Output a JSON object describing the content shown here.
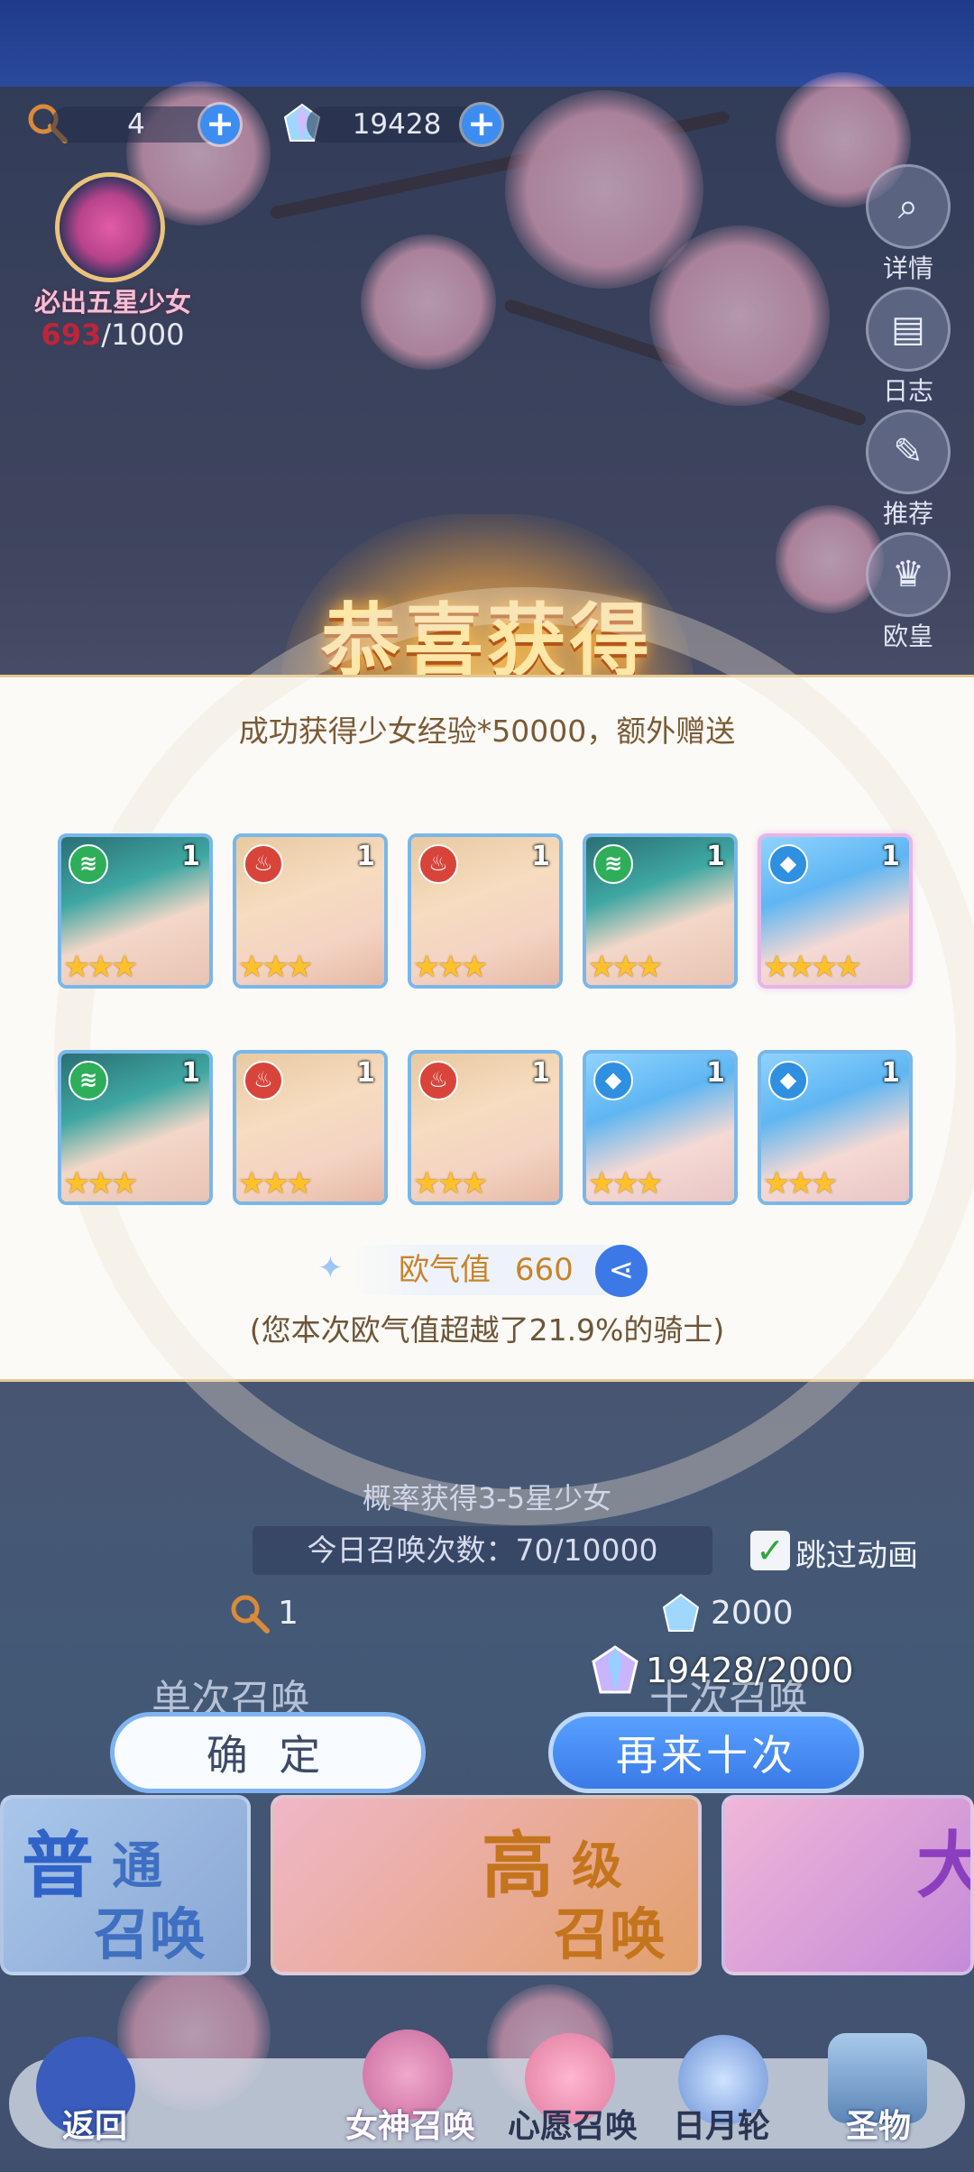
{
  "resources": {
    "ticket_count": "4",
    "gem_count": "19428"
  },
  "guarantee": {
    "title": "必出五星少女",
    "current": "693",
    "total": "/1000"
  },
  "side_menu": [
    {
      "label": "详情",
      "icon": "magnifier-icon"
    },
    {
      "label": "日志",
      "icon": "book-icon"
    },
    {
      "label": "推荐",
      "icon": "feather-icon"
    },
    {
      "label": "欧皇",
      "icon": "crown-icon"
    }
  ],
  "reward": {
    "title": "恭喜获得",
    "message": "成功获得少女经验*50000，额外赠送",
    "cards": [
      {
        "element": "wind",
        "level": "1",
        "stars": "★★★"
      },
      {
        "element": "fire",
        "level": "1",
        "stars": "★★★"
      },
      {
        "element": "fire",
        "level": "1",
        "stars": "★★★"
      },
      {
        "element": "wind",
        "level": "1",
        "stars": "★★★"
      },
      {
        "element": "water",
        "level": "1",
        "stars": "★★★★"
      },
      {
        "element": "wind",
        "level": "1",
        "stars": "★★★"
      },
      {
        "element": "fire",
        "level": "1",
        "stars": "★★★"
      },
      {
        "element": "fire",
        "level": "1",
        "stars": "★★★"
      },
      {
        "element": "water",
        "level": "1",
        "stars": "★★★"
      },
      {
        "element": "water",
        "level": "1",
        "stars": "★★★"
      }
    ],
    "luck_label": "欧气值",
    "luck_value": "660",
    "luck_sub": "(您本次欧气值超越了21.9%的骑士)"
  },
  "summon": {
    "probability_text": "概率获得3-5星少女",
    "today_count": "今日召唤次数：70/10000",
    "skip_label": "跳过动画",
    "single_cost": "1",
    "ten_cost": "2000",
    "single_label": "单次召唤",
    "ten_label": "十次召唤",
    "gem_progress": "19428/2000",
    "confirm_label": "确 定",
    "again_label": "再来十次"
  },
  "banners": {
    "normal_line1": "普",
    "normal_line1b": "通",
    "normal_line2": "召唤",
    "advanced_line1": "高",
    "advanced_line1b": "级",
    "advanced_line2": "召唤",
    "third": "大"
  },
  "nav": {
    "back": "返回",
    "goddess": "女神召唤",
    "wish": "心愿召唤",
    "sunmoon": "日月轮",
    "relic": "圣物"
  },
  "colors": {
    "accent_blue": "#3c79e6",
    "gold_title": "#ffe7a8",
    "star_gold": "#ffc12a",
    "modal_bg": "#fbfaf7"
  }
}
